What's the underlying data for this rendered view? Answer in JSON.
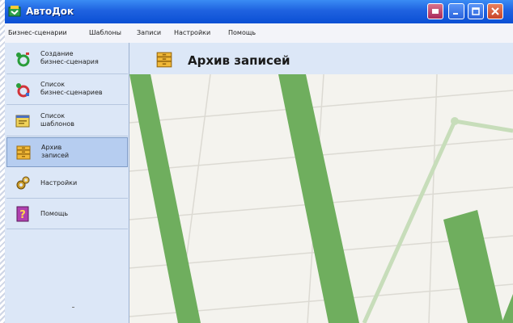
{
  "window": {
    "title": "АвтоДок"
  },
  "menu": [
    "Бизнес-сценарии",
    "Шаблоны",
    "Записи",
    "Настройки",
    "Помощь"
  ],
  "sidebar": {
    "items": [
      {
        "label": "Создание\nбизнес-сценария",
        "icon": "create-scenario-icon",
        "active": false
      },
      {
        "label": "Список\nбизнес-сценариев",
        "icon": "scenario-list-icon",
        "active": false
      },
      {
        "label": "Список\nшаблонов",
        "icon": "template-list-icon",
        "active": false
      },
      {
        "label": "Архив\nзаписей",
        "icon": "records-archive-icon",
        "active": true
      },
      {
        "label": "Настройки",
        "icon": "settings-gears-icon",
        "active": false
      },
      {
        "label": "Помощь",
        "icon": "help-icon",
        "active": false
      }
    ]
  },
  "content": {
    "title": "Архив записей",
    "icon": "records-archive-icon"
  },
  "colors": {
    "titlebar": "#1f62e0",
    "sidebar_bg": "#dce7f7",
    "active_item": "#b6cdf0",
    "bar_green": "#6fae5e"
  }
}
